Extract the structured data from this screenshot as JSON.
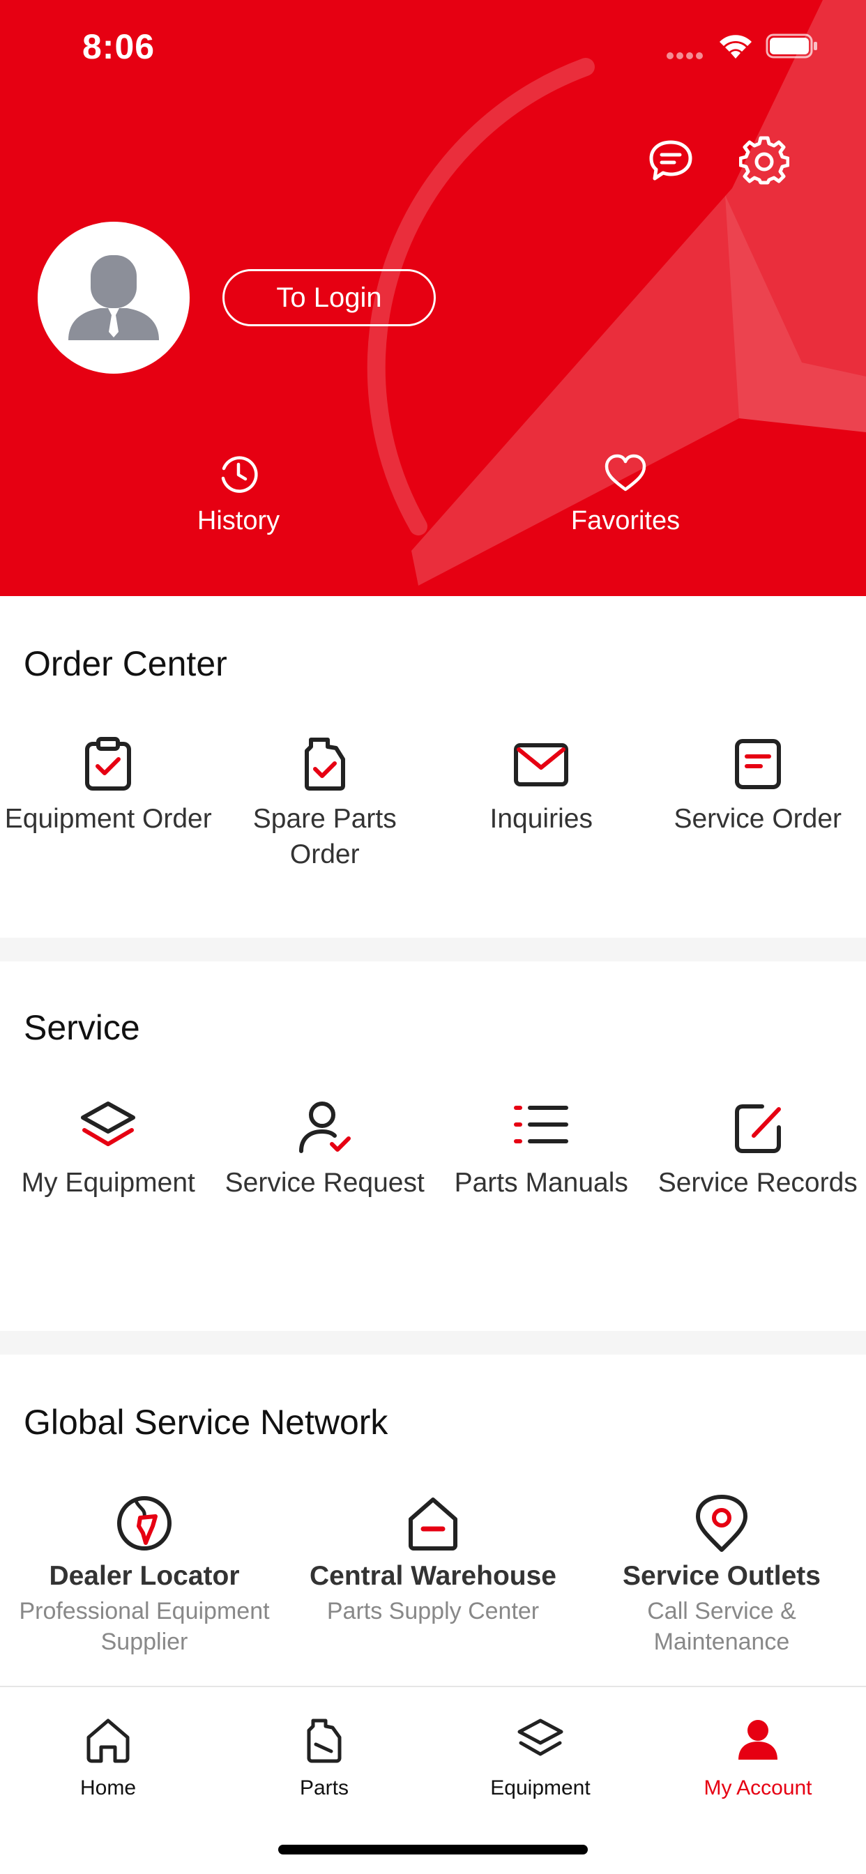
{
  "status_bar": {
    "time": "8:06"
  },
  "header": {
    "login_label": "To Login",
    "history_label": "History",
    "favorites_label": "Favorites"
  },
  "order_center": {
    "title": "Order Center",
    "items": [
      {
        "label": "Equipment Order",
        "icon": "clipboard-check-icon"
      },
      {
        "label": "Spare Parts Order",
        "icon": "oil-can-check-icon"
      },
      {
        "label": "Inquiries",
        "icon": "envelope-icon"
      },
      {
        "label": "Service Order",
        "icon": "form-icon"
      }
    ]
  },
  "service": {
    "title": "Service",
    "items": [
      {
        "label": "My Equipment",
        "icon": "layers-icon"
      },
      {
        "label": "Service Request",
        "icon": "user-check-icon"
      },
      {
        "label": "Parts Manuals",
        "icon": "list-icon"
      },
      {
        "label": "Service Records",
        "icon": "edit-icon"
      }
    ]
  },
  "network": {
    "title": "Global Service Network",
    "items": [
      {
        "title": "Dealer Locator",
        "subtitle": "Professional Equipment Supplier",
        "icon": "globe-icon"
      },
      {
        "title": "Central Warehouse",
        "subtitle": "Parts Supply Center",
        "icon": "warehouse-icon"
      },
      {
        "title": "Service Outlets",
        "subtitle": "Call Service & Maintenance",
        "icon": "location-pin-icon"
      }
    ]
  },
  "tabs": [
    {
      "label": "Home",
      "icon": "home-icon",
      "active": false
    },
    {
      "label": "Parts",
      "icon": "parts-icon",
      "active": false
    },
    {
      "label": "Equipment",
      "icon": "layers-icon",
      "active": false
    },
    {
      "label": "My Account",
      "icon": "person-icon",
      "active": true
    }
  ],
  "colors": {
    "accent": "#e60012",
    "text": "#333333",
    "muted": "#888888"
  }
}
